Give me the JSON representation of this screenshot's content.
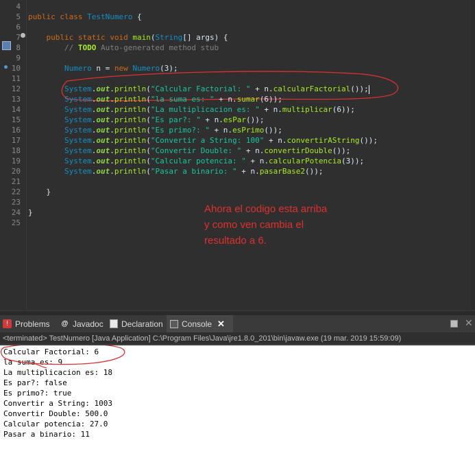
{
  "editor": {
    "lines": [
      {
        "num": "4",
        "segments": []
      },
      {
        "num": "5",
        "segments": [
          {
            "t": "public class ",
            "c": "kw"
          },
          {
            "t": "TestNumero",
            "c": "cls"
          },
          {
            "t": " {",
            "c": "dv"
          }
        ]
      },
      {
        "num": "6",
        "segments": []
      },
      {
        "num": "7",
        "segments": [
          {
            "t": "    ",
            "c": "dv"
          },
          {
            "t": "public static void ",
            "c": "kw"
          },
          {
            "t": "main",
            "c": "mth"
          },
          {
            "t": "(",
            "c": "dv"
          },
          {
            "t": "String",
            "c": "cls"
          },
          {
            "t": "[] args) {",
            "c": "dv"
          }
        ]
      },
      {
        "num": "8",
        "segments": [
          {
            "t": "        // ",
            "c": "cmt"
          },
          {
            "t": "TODO",
            "c": "todo"
          },
          {
            "t": " Auto-generated method stub",
            "c": "cmt"
          }
        ]
      },
      {
        "num": "9",
        "segments": []
      },
      {
        "num": "10",
        "segments": [
          {
            "t": "        ",
            "c": "dv"
          },
          {
            "t": "Numero",
            "c": "cls"
          },
          {
            "t": " n = ",
            "c": "dv"
          },
          {
            "t": "new ",
            "c": "kw"
          },
          {
            "t": "Numero",
            "c": "cls"
          },
          {
            "t": "(3);",
            "c": "dv"
          }
        ]
      },
      {
        "num": "11",
        "segments": []
      },
      {
        "num": "12",
        "segments": [
          {
            "t": "        ",
            "c": "dv"
          },
          {
            "t": "System",
            "c": "cls"
          },
          {
            "t": ".",
            "c": "dv"
          },
          {
            "t": "out",
            "c": "fld"
          },
          {
            "t": ".",
            "c": "dv"
          },
          {
            "t": "println",
            "c": "call"
          },
          {
            "t": "(",
            "c": "dv"
          },
          {
            "t": "\"Calcular Factorial: \"",
            "c": "str"
          },
          {
            "t": " + n.",
            "c": "dv"
          },
          {
            "t": "calcularFactorial",
            "c": "call"
          },
          {
            "t": "());",
            "c": "dv"
          },
          {
            "t": "CURSOR",
            "c": "cursor"
          }
        ]
      },
      {
        "num": "13",
        "segments": [
          {
            "t": "        ",
            "c": "dv"
          },
          {
            "t": "System",
            "c": "cls"
          },
          {
            "t": ".",
            "c": "dv"
          },
          {
            "t": "out",
            "c": "fld"
          },
          {
            "t": ".",
            "c": "dv"
          },
          {
            "t": "println",
            "c": "call"
          },
          {
            "t": "(",
            "c": "dv"
          },
          {
            "t": "\"la suma es: \"",
            "c": "str"
          },
          {
            "t": " + n.",
            "c": "dv"
          },
          {
            "t": "sumar",
            "c": "call"
          },
          {
            "t": "(6));",
            "c": "dv"
          }
        ]
      },
      {
        "num": "14",
        "segments": [
          {
            "t": "        ",
            "c": "dv"
          },
          {
            "t": "System",
            "c": "cls"
          },
          {
            "t": ".",
            "c": "dv"
          },
          {
            "t": "out",
            "c": "fld"
          },
          {
            "t": ".",
            "c": "dv"
          },
          {
            "t": "println",
            "c": "call"
          },
          {
            "t": "(",
            "c": "dv"
          },
          {
            "t": "\"La multiplicacion es: \"",
            "c": "str"
          },
          {
            "t": " + n.",
            "c": "dv"
          },
          {
            "t": "multiplicar",
            "c": "call"
          },
          {
            "t": "(6));",
            "c": "dv"
          }
        ]
      },
      {
        "num": "15",
        "segments": [
          {
            "t": "        ",
            "c": "dv"
          },
          {
            "t": "System",
            "c": "cls"
          },
          {
            "t": ".",
            "c": "dv"
          },
          {
            "t": "out",
            "c": "fld"
          },
          {
            "t": ".",
            "c": "dv"
          },
          {
            "t": "println",
            "c": "call"
          },
          {
            "t": "(",
            "c": "dv"
          },
          {
            "t": "\"Es par?: \"",
            "c": "str"
          },
          {
            "t": " + n.",
            "c": "dv"
          },
          {
            "t": "esPar",
            "c": "call"
          },
          {
            "t": "());",
            "c": "dv"
          }
        ]
      },
      {
        "num": "16",
        "segments": [
          {
            "t": "        ",
            "c": "dv"
          },
          {
            "t": "System",
            "c": "cls"
          },
          {
            "t": ".",
            "c": "dv"
          },
          {
            "t": "out",
            "c": "fld"
          },
          {
            "t": ".",
            "c": "dv"
          },
          {
            "t": "println",
            "c": "call"
          },
          {
            "t": "(",
            "c": "dv"
          },
          {
            "t": "\"Es primo?: \"",
            "c": "str"
          },
          {
            "t": " + n.",
            "c": "dv"
          },
          {
            "t": "esPrimo",
            "c": "call"
          },
          {
            "t": "());",
            "c": "dv"
          }
        ]
      },
      {
        "num": "17",
        "segments": [
          {
            "t": "        ",
            "c": "dv"
          },
          {
            "t": "System",
            "c": "cls"
          },
          {
            "t": ".",
            "c": "dv"
          },
          {
            "t": "out",
            "c": "fld"
          },
          {
            "t": ".",
            "c": "dv"
          },
          {
            "t": "println",
            "c": "call"
          },
          {
            "t": "(",
            "c": "dv"
          },
          {
            "t": "\"Convertir a String: 100\"",
            "c": "str"
          },
          {
            "t": " + n.",
            "c": "dv"
          },
          {
            "t": "convertirAString",
            "c": "call"
          },
          {
            "t": "());",
            "c": "dv"
          }
        ]
      },
      {
        "num": "18",
        "segments": [
          {
            "t": "        ",
            "c": "dv"
          },
          {
            "t": "System",
            "c": "cls"
          },
          {
            "t": ".",
            "c": "dv"
          },
          {
            "t": "out",
            "c": "fld"
          },
          {
            "t": ".",
            "c": "dv"
          },
          {
            "t": "println",
            "c": "call"
          },
          {
            "t": "(",
            "c": "dv"
          },
          {
            "t": "\"Convertir Double: \"",
            "c": "str"
          },
          {
            "t": " + n.",
            "c": "dv"
          },
          {
            "t": "convertirDouble",
            "c": "call"
          },
          {
            "t": "());",
            "c": "dv"
          }
        ]
      },
      {
        "num": "19",
        "segments": [
          {
            "t": "        ",
            "c": "dv"
          },
          {
            "t": "System",
            "c": "cls"
          },
          {
            "t": ".",
            "c": "dv"
          },
          {
            "t": "out",
            "c": "fld"
          },
          {
            "t": ".",
            "c": "dv"
          },
          {
            "t": "println",
            "c": "call"
          },
          {
            "t": "(",
            "c": "dv"
          },
          {
            "t": "\"Calcular potencia: \"",
            "c": "str"
          },
          {
            "t": " + n.",
            "c": "dv"
          },
          {
            "t": "calcularPotencia",
            "c": "call"
          },
          {
            "t": "(3));",
            "c": "dv"
          }
        ]
      },
      {
        "num": "20",
        "segments": [
          {
            "t": "        ",
            "c": "dv"
          },
          {
            "t": "System",
            "c": "cls"
          },
          {
            "t": ".",
            "c": "dv"
          },
          {
            "t": "out",
            "c": "fld"
          },
          {
            "t": ".",
            "c": "dv"
          },
          {
            "t": "println",
            "c": "call"
          },
          {
            "t": "(",
            "c": "dv"
          },
          {
            "t": "\"Pasar a binario: \"",
            "c": "str"
          },
          {
            "t": " + n.",
            "c": "dv"
          },
          {
            "t": "pasarBase2",
            "c": "call"
          },
          {
            "t": "());",
            "c": "dv"
          }
        ]
      },
      {
        "num": "21",
        "segments": []
      },
      {
        "num": "22",
        "segments": [
          {
            "t": "    }",
            "c": "dv"
          }
        ]
      },
      {
        "num": "23",
        "segments": []
      },
      {
        "num": "24",
        "segments": [
          {
            "t": "}",
            "c": "dv"
          }
        ]
      },
      {
        "num": "25",
        "segments": []
      }
    ],
    "annotation_note": "Ahora el codigo esta arriba y como ven cambia el resultado a 6.",
    "annotation_color": "#e03030"
  },
  "views": {
    "tabs": [
      {
        "label": "Problems",
        "icon": "problems-icon"
      },
      {
        "label": "Javadoc",
        "icon": "at-icon"
      },
      {
        "label": "Declaration",
        "icon": "declaration-icon"
      },
      {
        "label": "Console",
        "icon": "console-icon",
        "active": true
      }
    ],
    "status": "<terminated> TestNumero [Java Application] C:\\Program Files\\Java\\jre1.8.0_201\\bin\\javaw.exe (19 mar. 2019 15:59:09)"
  },
  "console": {
    "lines": [
      "Calcular Factorial: 6",
      "la suma es: 9",
      "La multiplicacion es: 18",
      "Es par?: false",
      "Es primo?: true",
      "Convertir a String: 1003",
      "Convertir Double: 500.0",
      "Calcular potencia: 27.0",
      "Pasar a binario: 11"
    ]
  },
  "colors": {
    "editor_bg": "#2f2f2f",
    "keyword": "#cc6c1d",
    "class": "#1290c3",
    "string": "#17c6a3",
    "method": "#a7ec21",
    "annotation_red": "#e03030"
  }
}
